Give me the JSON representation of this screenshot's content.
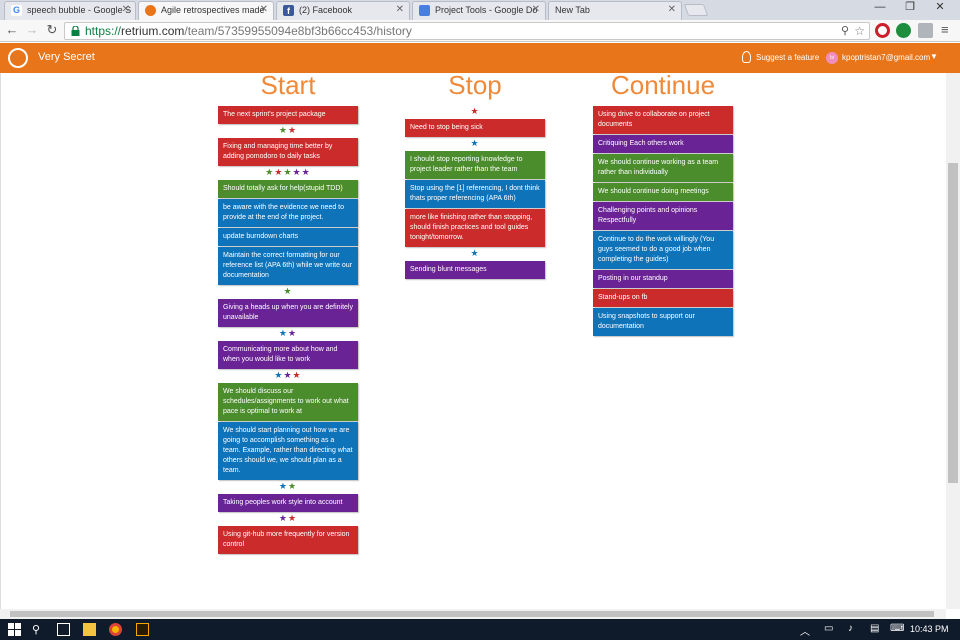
{
  "browser": {
    "tabs": [
      {
        "label": "speech bubble - Google S",
        "color": "#4285f4"
      },
      {
        "label": "Agile retrospectives made",
        "color": "#e8751a"
      },
      {
        "label": "(2) Facebook",
        "color": "#3b5998"
      },
      {
        "label": "Project Tools - Google Do",
        "color": "#4a7ee0"
      },
      {
        "label": "New Tab",
        "color": ""
      }
    ],
    "url_scheme": "https://",
    "url_host": "retrium.com",
    "url_path": "/team/57359955094e8bf3b66cc453/history"
  },
  "app": {
    "team_name": "Very Secret",
    "suggest_label": "Suggest a feature",
    "avatar_initials": "bi",
    "user_email": "kpoptristan7@gmail.com"
  },
  "columns": {
    "start": {
      "title": "Start",
      "items": [
        {
          "type": "card",
          "color": "red",
          "text": "The next sprint's project package"
        },
        {
          "type": "stars",
          "stars": [
            "green",
            "red"
          ]
        },
        {
          "type": "card",
          "color": "red",
          "text": "Fixing and managing time better by adding pomodoro to daily tasks"
        },
        {
          "type": "stars",
          "stars": [
            "green",
            "red",
            "green",
            "purple",
            "purple"
          ]
        },
        {
          "type": "card",
          "color": "green",
          "text": "Should totally ask for help(stupid TDD)"
        },
        {
          "type": "card",
          "color": "blue",
          "text": "be aware with the evidence we need to provide at the end of the project."
        },
        {
          "type": "card",
          "color": "blue",
          "text": "update burndown charts"
        },
        {
          "type": "card",
          "color": "blue",
          "text": "Maintain the correct formatting for our reference list (APA 6th) while we write our documentation"
        },
        {
          "type": "stars",
          "stars": [
            "green"
          ]
        },
        {
          "type": "card",
          "color": "purple",
          "text": "Giving a heads up when you are definitely unavailable"
        },
        {
          "type": "stars",
          "stars": [
            "blue",
            "purple"
          ]
        },
        {
          "type": "card",
          "color": "purple",
          "text": "Communicating more about how and when you would like to work"
        },
        {
          "type": "stars",
          "stars": [
            "blue",
            "purple",
            "red"
          ]
        },
        {
          "type": "card",
          "color": "green",
          "text": "We should discuss our schedules/assignments to work out what pace is optimal to work at"
        },
        {
          "type": "card",
          "color": "blue",
          "text": "We should start planning out how we are going to accomplish something as a team. Example, rather than directing what others should we, we should plan as a team."
        },
        {
          "type": "stars",
          "stars": [
            "blue",
            "green"
          ]
        },
        {
          "type": "card",
          "color": "purple",
          "text": "Taking peoples work style into account"
        },
        {
          "type": "stars",
          "stars": [
            "purple",
            "red"
          ]
        },
        {
          "type": "card",
          "color": "red",
          "text": "Using git-hub more frequently for version control"
        }
      ]
    },
    "stop": {
      "title": "Stop",
      "items": [
        {
          "type": "stars",
          "stars": [
            "red"
          ]
        },
        {
          "type": "card",
          "color": "red",
          "text": "Need to stop being sick"
        },
        {
          "type": "stars",
          "stars": [
            "blue"
          ]
        },
        {
          "type": "card",
          "color": "green",
          "text": "I should stop reporting knowledge to project leader rather than the team"
        },
        {
          "type": "card",
          "color": "blue",
          "text": "Stop using the [1] referencing, I dont think thats proper referencing (APA 6th)"
        },
        {
          "type": "card",
          "color": "red",
          "text": "more like finishing rather than stopping, should finish practices and tool guides tonight/tomorrow."
        },
        {
          "type": "stars",
          "stars": [
            "blue"
          ]
        },
        {
          "type": "card",
          "color": "purple",
          "text": "Sending blunt messages"
        }
      ]
    },
    "continue": {
      "title": "Continue",
      "items": [
        {
          "type": "card",
          "color": "red",
          "text": "Using drive to collaborate on project documents"
        },
        {
          "type": "card",
          "color": "purple",
          "text": "Critiquing Each others work"
        },
        {
          "type": "card",
          "color": "green",
          "text": "We should continue working as a team rather than individually"
        },
        {
          "type": "card",
          "color": "green",
          "text": "We should continue doing meetings"
        },
        {
          "type": "card",
          "color": "purple",
          "text": "Challenging points and opinions Respectfully"
        },
        {
          "type": "card",
          "color": "blue",
          "text": "Continue to do the work willingly (You guys seemed to do a good job when completing the guides)"
        },
        {
          "type": "card",
          "color": "purple",
          "text": "Posting in our standup"
        },
        {
          "type": "card",
          "color": "red",
          "text": "Stand-ups on fb"
        },
        {
          "type": "card",
          "color": "blue",
          "text": "Using snapshots to support our documentation"
        }
      ]
    }
  },
  "taskbar": {
    "time": "10:43 PM"
  }
}
